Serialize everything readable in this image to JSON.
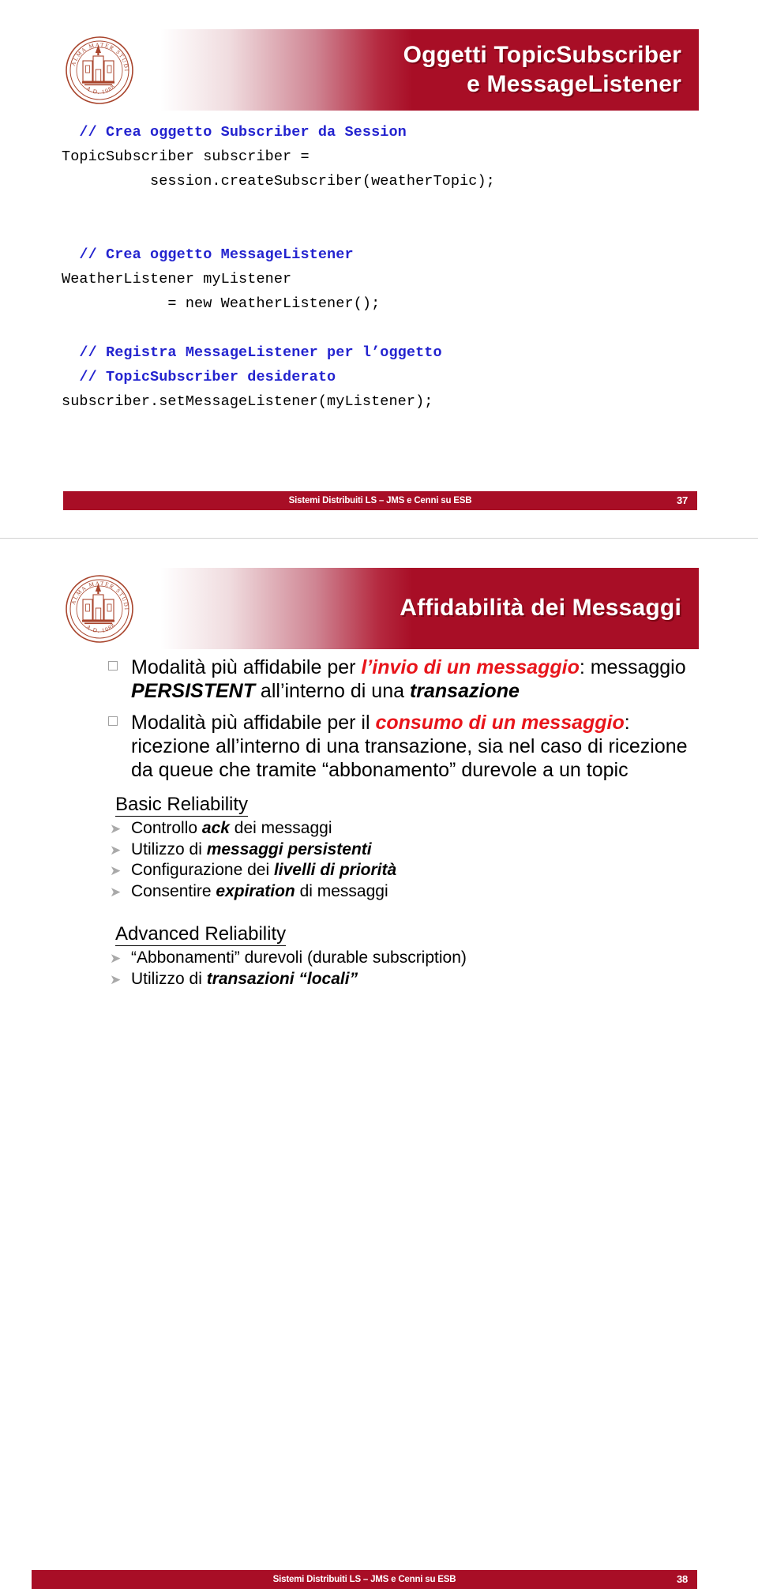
{
  "theme": {
    "accent_red": "#A80E26",
    "comment_blue": "#2323CF",
    "highlight_red": "#E8151B",
    "bullet_gray": "#A0A0A0"
  },
  "logo": {
    "name": "alma-mater-studiorum-seal",
    "top_text": "ALMA MATER STUDIORUM",
    "bottom_text": "A.D. 1088"
  },
  "slide_1": {
    "title_line_1": "Oggetti TopicSubscriber",
    "title_line_2": "e MessageListener",
    "code": [
      {
        "text": "  // Crea oggetto Subscriber da Session",
        "kind": "comment"
      },
      {
        "text": "TopicSubscriber subscriber =",
        "kind": "code"
      },
      {
        "text": "          session.createSubscriber(weatherTopic);",
        "kind": "code"
      },
      {
        "text": "",
        "kind": "blank"
      },
      {
        "text": "",
        "kind": "blank"
      },
      {
        "text": "  // Crea oggetto MessageListener",
        "kind": "comment"
      },
      {
        "text": "WeatherListener myListener",
        "kind": "code"
      },
      {
        "text": "            = new WeatherListener();",
        "kind": "code"
      },
      {
        "text": "",
        "kind": "blank"
      },
      {
        "text": "  // Registra MessageListener per l’oggetto",
        "kind": "comment"
      },
      {
        "text": "  // TopicSubscriber desiderato",
        "kind": "comment"
      },
      {
        "text": "subscriber.setMessageListener(myListener);",
        "kind": "code"
      }
    ],
    "footer_text": "Sistemi Distribuiti LS – JMS e Cenni su ESB",
    "page_number": "37"
  },
  "slide_2": {
    "title_line_1": "Affidabilità dei Messaggi",
    "bullets": [
      {
        "parts": [
          {
            "t": "Modalità più affidabile per ",
            "s": "plain"
          },
          {
            "t": "l’invio di un messaggio",
            "s": "red-bold-italic"
          },
          {
            "t": ": messaggio ",
            "s": "plain"
          },
          {
            "t": "PERSISTENT",
            "s": "black-bold-italic"
          },
          {
            "t": " all’interno di una ",
            "s": "plain"
          },
          {
            "t": "transazione",
            "s": "black-bold-italic"
          }
        ]
      },
      {
        "parts": [
          {
            "t": "Modalità più affidabile per il ",
            "s": "plain"
          },
          {
            "t": "consumo di un messaggio",
            "s": "red-bold-italic"
          },
          {
            "t": ": ricezione all’interno di una transazione, sia nel caso di ricezione da queue che tramite “abbonamento” durevole a un topic",
            "s": "plain"
          }
        ]
      }
    ],
    "sections": [
      {
        "heading": "Basic Reliability",
        "items": [
          {
            "parts": [
              {
                "t": "Controllo ",
                "s": "plain"
              },
              {
                "t": "ack",
                "s": "bold-italic"
              },
              {
                "t": " dei messaggi",
                "s": "plain"
              }
            ]
          },
          {
            "parts": [
              {
                "t": "Utilizzo di ",
                "s": "plain"
              },
              {
                "t": "messaggi persistenti",
                "s": "bold-italic"
              }
            ]
          },
          {
            "parts": [
              {
                "t": "Configurazione dei ",
                "s": "plain"
              },
              {
                "t": "livelli di priorità",
                "s": "bold-italic"
              }
            ]
          },
          {
            "parts": [
              {
                "t": "Consentire ",
                "s": "plain"
              },
              {
                "t": "expiration",
                "s": "bold-italic"
              },
              {
                "t": " di messaggi",
                "s": "plain"
              }
            ]
          }
        ]
      },
      {
        "heading": "Advanced Reliability",
        "items": [
          {
            "parts": [
              {
                "t": "“Abbonamenti” durevoli (durable subscription)",
                "s": "plain"
              }
            ]
          },
          {
            "parts": [
              {
                "t": "Utilizzo di ",
                "s": "plain"
              },
              {
                "t": "transazioni “locali”",
                "s": "bold-italic"
              }
            ]
          }
        ]
      }
    ],
    "footer_text": "Sistemi Distribuiti LS – JMS e Cenni su ESB",
    "page_number": "38"
  },
  "bullet_glyphs": {
    "square": "",
    "arrow": "➤"
  }
}
